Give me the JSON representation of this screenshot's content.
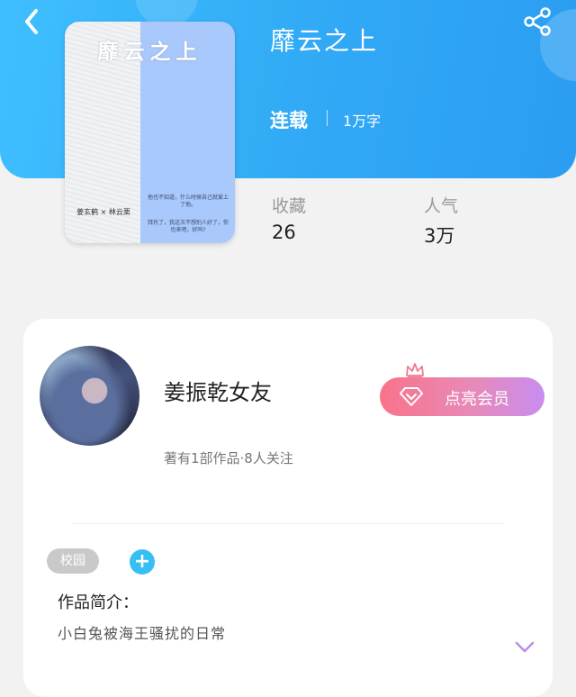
{
  "header": {
    "back_icon": "chevron-left-icon",
    "share_icon": "share-icon",
    "background_color": "#31a9f5"
  },
  "cover": {
    "title": "靡云之上",
    "authors": "姜玄鹤 × 林云栗",
    "text_line1": "他也不知道，什么时候自己就爱上了他。",
    "text_line2": "拜托了，我这次不想别人好了，你也来吧，好吗?"
  },
  "book": {
    "title": "靡云之上",
    "status": "连载",
    "word_count": "1万字"
  },
  "stats": [
    {
      "label": "收藏",
      "value": "26"
    },
    {
      "label": "人气",
      "value": "3万"
    }
  ],
  "author": {
    "name": "姜振乾女友",
    "meta": "著有1部作品·8人关注",
    "vip_button_label": "点亮会员",
    "vip_gradient_start": "#f9738a",
    "vip_gradient_end": "#c78df0"
  },
  "tags": [
    "校园"
  ],
  "add_tag_label": "+",
  "intro": {
    "heading": "作品简介：",
    "text": "小白兔被海王骚扰的日常"
  }
}
